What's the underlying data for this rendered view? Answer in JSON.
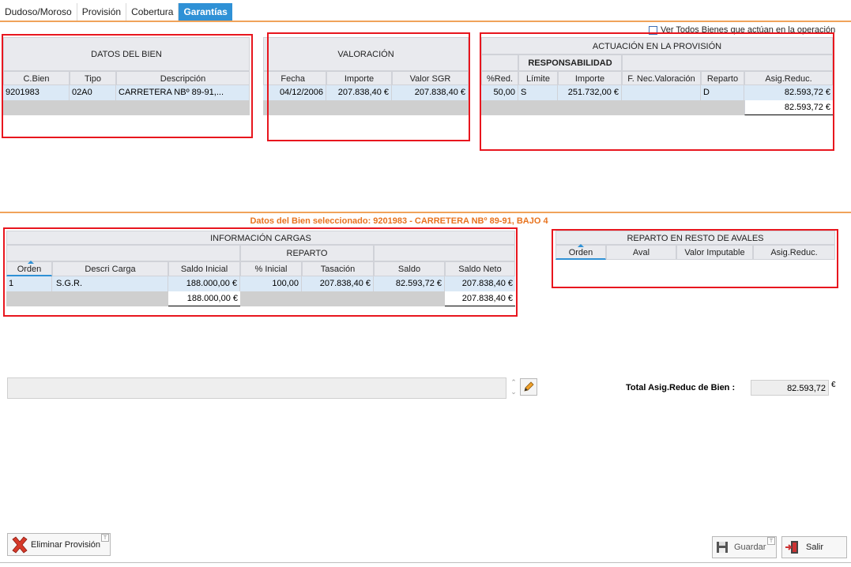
{
  "tabs": [
    "Dudoso/Moroso",
    "Provisión",
    "Cobertura",
    "Garantías"
  ],
  "ver_todos_label": "Ver Todos Bienes que actúan en la operación",
  "datos_bien": {
    "title": "DATOS DEL BIEN",
    "columns": [
      "C.Bien",
      "Tipo",
      "Descripción"
    ],
    "row": [
      "9201983",
      "02A0",
      "CARRETERA  NBº  89-91,..."
    ]
  },
  "valoracion": {
    "title": "VALORACIÓN",
    "columns": [
      "Fecha",
      "Importe",
      "Valor SGR"
    ],
    "row": [
      "04/12/2006",
      "207.838,40 €",
      "207.838,40 €"
    ]
  },
  "actuacion": {
    "title": "ACTUACIÓN EN LA PROVISIÓN",
    "sub_title": "RESPONSABILIDAD",
    "columns": [
      "%Red.",
      "Límite",
      "Importe",
      "F. Nec.Valoración",
      "Reparto",
      "Asig.Reduc."
    ],
    "row": [
      "50,00",
      "S",
      "251.732,00 €",
      "",
      "D",
      "82.593,72 €"
    ],
    "total": "82.593,72 €"
  },
  "selected_label": "Datos del Bien seleccionado: 9201983 - CARRETERA  NBº 89-91, BAJO 4",
  "cargas": {
    "title": "INFORMACIÓN CARGAS",
    "sub_title": "REPARTO",
    "columns": [
      "Orden",
      "Descri Carga",
      "Saldo Inicial",
      "% Inicial",
      "Tasación",
      "Saldo",
      "Saldo Neto"
    ],
    "row": [
      "1",
      "S.G.R.",
      "188.000,00 €",
      "100,00",
      "207.838,40 €",
      "82.593,72 €",
      "207.838,40 €"
    ],
    "total_saldo_inicial": "188.000,00 €",
    "total_saldo_neto": "207.838,40 €"
  },
  "reparto_avales": {
    "title": "REPARTO EN RESTO DE AVALES",
    "columns": [
      "Orden",
      "Aval",
      "Valor Imputable",
      "Asig.Reduc."
    ]
  },
  "total_asig_label": "Total Asig.Reduc de Bien :",
  "total_asig_value": "82.593,72",
  "currency": "€",
  "buttons": {
    "eliminar": "Eliminar Provisión",
    "guardar": "Guardar",
    "salir": "Salir"
  },
  "tiny_mark": "T"
}
